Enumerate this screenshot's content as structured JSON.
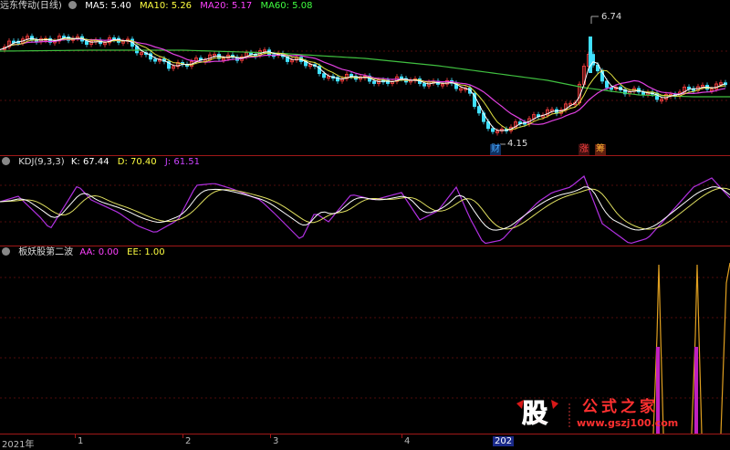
{
  "main_panel": {
    "title": "远东传动(日线)",
    "ma5": "MA5: 5.40",
    "ma10": "MA10: 5.26",
    "ma20": "MA20: 5.17",
    "ma60": "MA60: 5.08",
    "high_label": "6.74",
    "low_label": "4.15",
    "badge_cai": "财",
    "badge_zhang": "涨",
    "badge_chou": "筹"
  },
  "kdj_panel": {
    "title": "KDJ(9,3,3)",
    "k": "K: 67.44",
    "d": "D: 70.40",
    "j": "J: 61.51"
  },
  "custom_panel": {
    "title": "板妖股第二波",
    "aa": "AA: 0.00",
    "ee": "EE: 1.00"
  },
  "x_axis": {
    "labels": [
      "2021年",
      "1",
      "2",
      "3",
      "4",
      "202"
    ]
  },
  "watermark": {
    "logo_text": "股",
    "site_name": "公式之家",
    "url": "www.gszj100.com"
  },
  "colors": {
    "ma5": "#ffffff",
    "ma10": "#ffff40",
    "ma20": "#ff40ff",
    "ma60": "#40ff40",
    "up": "#ff4040",
    "down": "#40e0ff",
    "k": "#ffffff",
    "d": "#ffff40",
    "j": "#cc44ff",
    "grid": "#a01818"
  }
}
